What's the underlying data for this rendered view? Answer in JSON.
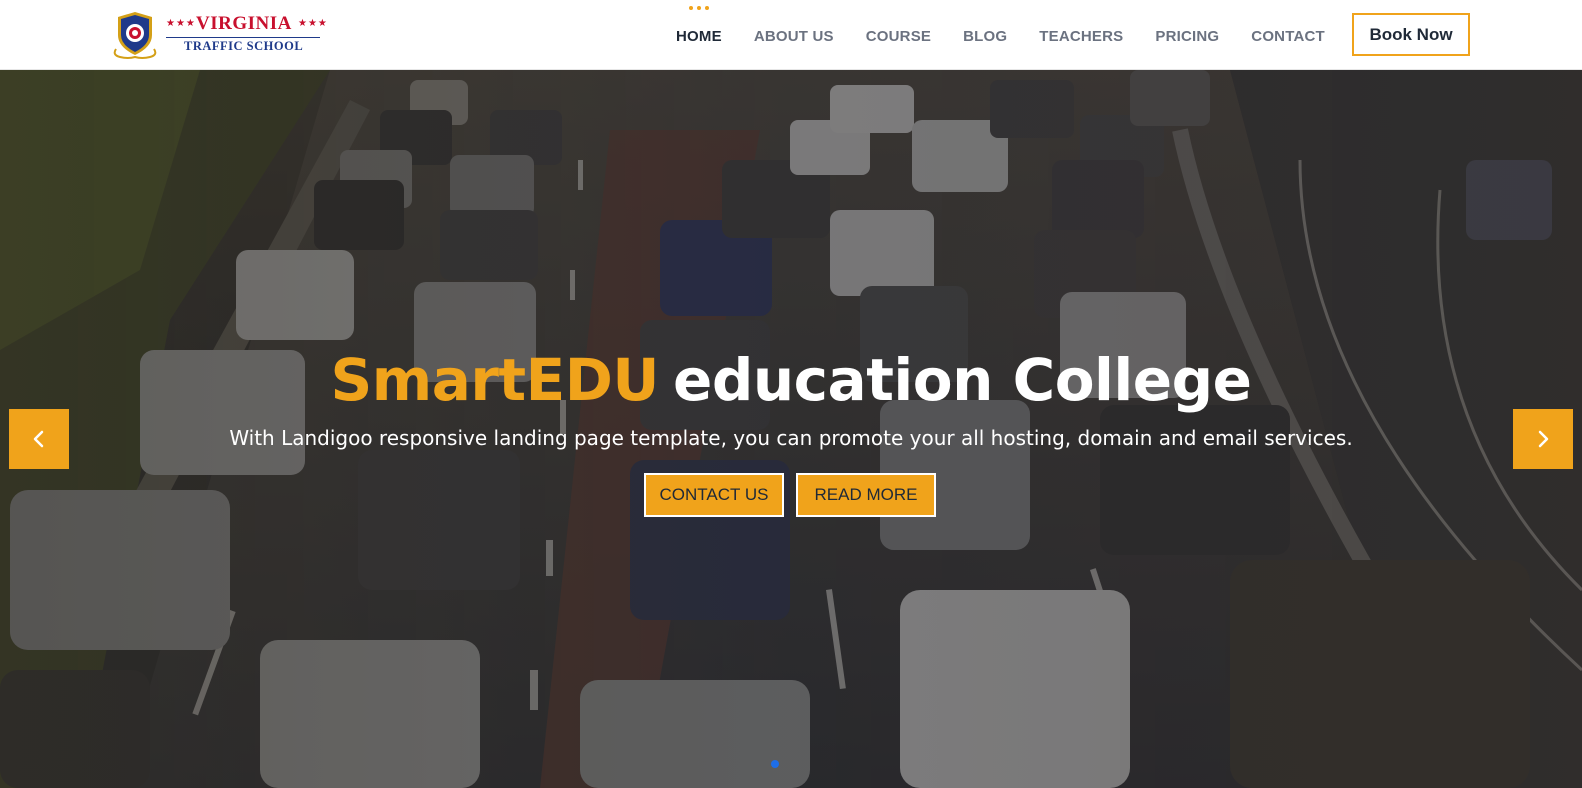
{
  "brand": {
    "name": "VIRGINIA",
    "subtitle": "TRAFFIC SCHOOL",
    "stars": "★★★",
    "colors": {
      "red": "#c8102e",
      "navy": "#1f3a8a"
    },
    "seal_icon": "shield-seal-icon"
  },
  "nav": {
    "items": [
      {
        "label": "HOME",
        "active": true
      },
      {
        "label": "ABOUT US",
        "active": false
      },
      {
        "label": "COURSE",
        "active": false
      },
      {
        "label": "BLOG",
        "active": false
      },
      {
        "label": "TEACHERS",
        "active": false
      },
      {
        "label": "PRICING",
        "active": false
      },
      {
        "label": "CONTACT",
        "active": false
      }
    ],
    "cta_label": "Book Now"
  },
  "hero": {
    "title_accent": "SmartEDU",
    "title_rest": "education College",
    "subtitle": "With Landigoo responsive landing page template, you can promote your all hosting, domain and email services.",
    "buttons": {
      "contact": "CONTACT US",
      "read_more": "READ MORE"
    },
    "prev_icon": "chevron-left-icon",
    "next_icon": "chevron-right-icon",
    "background": "traffic-highway-photo"
  },
  "carousel": {
    "active_slide": 1,
    "slide_count": 1
  },
  "colors": {
    "accent": "#f0a31b",
    "indicator": "#1e6ee8",
    "nav_text": "#6b7280",
    "nav_active": "#1f2937"
  }
}
